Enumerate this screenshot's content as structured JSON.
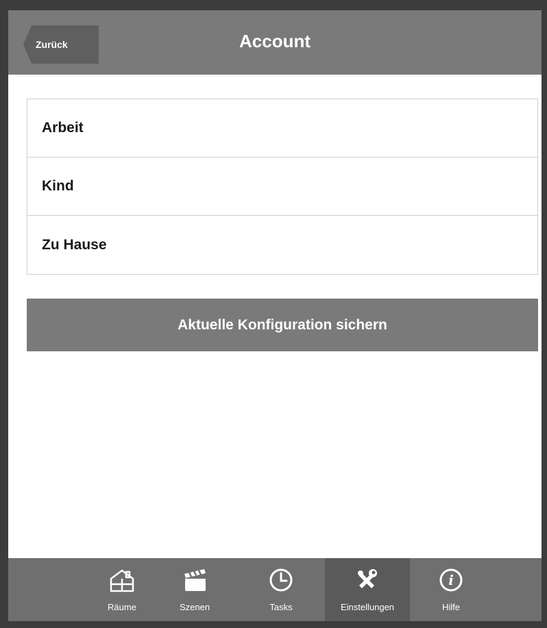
{
  "header": {
    "back_label": "Zurück",
    "title": "Account"
  },
  "list": {
    "items": [
      {
        "label": "Arbeit"
      },
      {
        "label": "Kind"
      },
      {
        "label": "Zu Hause"
      }
    ]
  },
  "save_button": {
    "label": "Aktuelle Konfiguration sichern"
  },
  "tabbar": {
    "tabs": [
      {
        "label": "Räume",
        "icon": "house-icon"
      },
      {
        "label": "Szenen",
        "icon": "clapperboard-icon"
      },
      {
        "label": "Tasks",
        "icon": "clock-icon"
      },
      {
        "label": "Einstellungen",
        "icon": "tools-icon",
        "active": true
      },
      {
        "label": "Hilfe",
        "icon": "info-icon"
      }
    ]
  },
  "colors": {
    "header_bg": "#7a7a7a",
    "back_button_bg": "#5f5f5f",
    "tabbar_bg": "#6f6f6f",
    "tab_active_bg": "#5a5a5a"
  }
}
